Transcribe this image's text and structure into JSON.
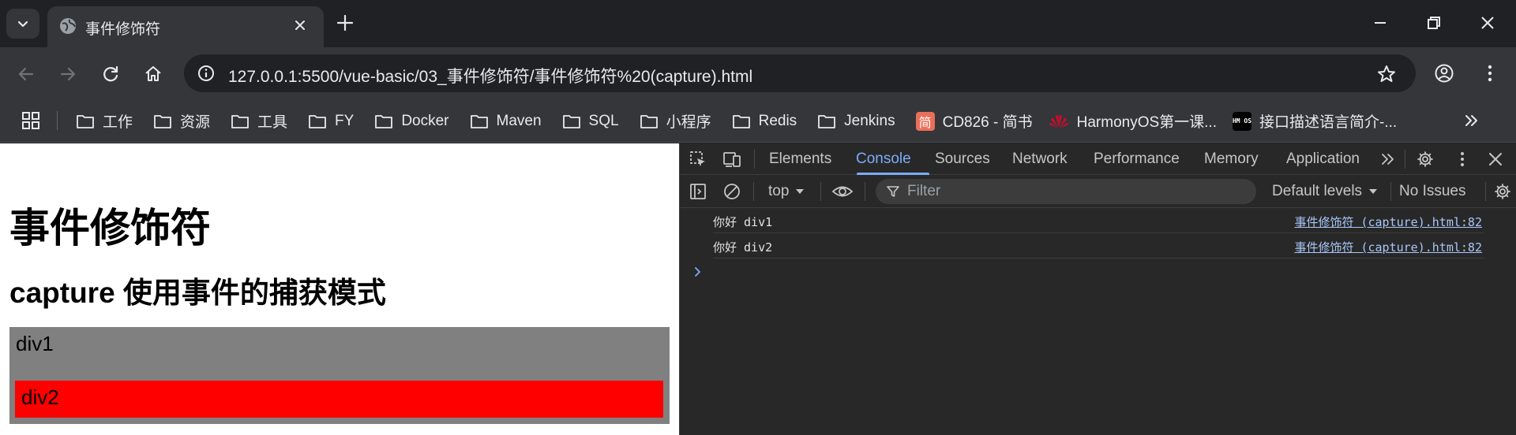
{
  "browser": {
    "tab_title": "事件修饰符",
    "url": "127.0.0.1:5500/vue-basic/03_事件修饰符/事件修饰符%20(capture).html"
  },
  "bookmarks": [
    {
      "label": "工作",
      "icon": "folder-icon"
    },
    {
      "label": "资源",
      "icon": "folder-icon"
    },
    {
      "label": "工具",
      "icon": "folder-icon"
    },
    {
      "label": "FY",
      "icon": "folder-icon"
    },
    {
      "label": "Docker",
      "icon": "folder-icon"
    },
    {
      "label": "Maven",
      "icon": "folder-icon"
    },
    {
      "label": "SQL",
      "icon": "folder-icon"
    },
    {
      "label": "小程序",
      "icon": "folder-icon"
    },
    {
      "label": "Redis",
      "icon": "folder-icon"
    },
    {
      "label": "Jenkins",
      "icon": "folder-icon"
    },
    {
      "label": "CD826 - 简书",
      "icon": "jianshu-logo",
      "logo_text": "简"
    },
    {
      "label": "HarmonyOS第一课...",
      "icon": "huawei-logo"
    },
    {
      "label": "接口描述语言简介-...",
      "icon": "hmos-logo",
      "logo_text": "HM OS"
    }
  ],
  "page": {
    "heading": "事件修饰符",
    "subheading": "capture 使用事件的捕获模式",
    "div1_label": "div1",
    "div2_label": "div2",
    "div1_color": "#808080",
    "div2_color": "#ff0000"
  },
  "devtools": {
    "tabs": [
      "Elements",
      "Console",
      "Sources",
      "Network",
      "Performance",
      "Memory",
      "Application"
    ],
    "active_tab": "Console",
    "context": "top",
    "filter_placeholder": "Filter",
    "levels": "Default levels",
    "issues": "No Issues",
    "logs": [
      {
        "message": "你好 div1",
        "source": "事件修饰符 (capture).html:82"
      },
      {
        "message": "你好 div2",
        "source": "事件修饰符 (capture).html:82"
      }
    ]
  },
  "colors": {
    "accent": "#7cacf8",
    "link": "#a8c7fa"
  }
}
